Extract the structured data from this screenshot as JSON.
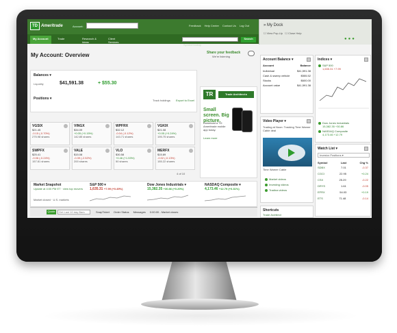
{
  "header": {
    "logo_box": "TD",
    "logo_name": "Ameritrade",
    "account_label": "Account:",
    "links": [
      "Feedback",
      "Help Center",
      "Contact Us",
      "Log Out"
    ],
    "search_button": "Search",
    "symbol_lookup": "Symbol lookup"
  },
  "nav": {
    "tabs": [
      "My Account",
      "Trade",
      "Research & Ideas",
      "Client Services"
    ]
  },
  "dock": {
    "title": "My Dock",
    "option1": "View Pop-Up",
    "option2": "Close Help"
  },
  "page": {
    "title": "My Account: Overview",
    "feedback": "Share your feedback",
    "feedback_sub": "We're listening"
  },
  "balances": {
    "title": "Balances",
    "label": "Liquidity",
    "value": "$41,591.38",
    "change": "+ $55.30"
  },
  "positions": {
    "title": "Positions",
    "track": "Track holdings",
    "export": "Export to Excel",
    "nav": "4 of 10",
    "cards": [
      {
        "symbol": "VGSIX",
        "price": "$21.45",
        "change": "-0.15 (-0.70%)",
        "shares": "275.98 shares",
        "dir": "dn"
      },
      {
        "symbol": "VINGX",
        "price": "$34.09",
        "change": "+0.05 (+0.15%)",
        "shares": "142.85 shares",
        "dir": "up"
      },
      {
        "symbol": "WPFRX",
        "price": "$32.12",
        "change": "-0.04 (-0.12%)",
        "shares": "143.71 shares",
        "dir": "dn"
      },
      {
        "symbol": "VGKIX",
        "price": "$21.08",
        "change": "+0.05 (+0.24%)",
        "shares": "195.75 shares",
        "dir": "up"
      },
      {
        "symbol": "SWPFX",
        "price": "$25.41",
        "change": "-0.06 (-0.24%)",
        "shares": "157.81 shares",
        "dir": "dn"
      },
      {
        "symbol": "VALE",
        "price": "$15.08",
        "change": "-0.39 (-2.52%)",
        "shares": "200 shares",
        "dir": "dn"
      },
      {
        "symbol": "VLO",
        "price": "$30.58",
        "change": "+0.46 (+1.53%)",
        "shares": "50 shares",
        "dir": "up"
      },
      {
        "symbol": "MERFX",
        "price": "$15.89",
        "change": "-0.02 (-0.13%)",
        "shares": "155.22 shares",
        "dir": "dn"
      }
    ]
  },
  "ad": {
    "badge": "TR",
    "button": "Trade Architect",
    "headline": "Small screen. Big picture.",
    "body": "Download a TD Ameritrade mobile app today.",
    "learn": "Learn more"
  },
  "market": {
    "title": "Market Snapshot",
    "text": "Update at 4:00 PM ET · view top movers",
    "status": "Market closed · U.S. markets",
    "sp": {
      "name": "S&P 500",
      "value": "1,635.31",
      "change": "+7.99 (+0.49%)"
    },
    "dow": {
      "name": "Dow Jones Industrials",
      "value": "15,382.35",
      "change": "+30.86 (+0.20%)"
    },
    "nasdaq": {
      "name": "NASDAQ Composite",
      "value": "4,173.46",
      "change": "+12.79 (+0.31%)"
    }
  },
  "statusbar": {
    "quote": "Quote",
    "quote_placeholder": "Get Last 10 day Bars",
    "items": [
      "SnapTicket",
      "Order Status",
      "Messages",
      "0:00:00 - Market closes"
    ]
  },
  "account_balance": {
    "title": "Account Balance",
    "col1": "Account",
    "col2": "Balance",
    "rows": [
      {
        "label": "Individual",
        "value": "$41,591.38"
      },
      {
        "label": "Cash & sweep vehicle",
        "value": "$555.52"
      },
      {
        "label": "Stocks",
        "value": "$600.00"
      },
      {
        "label": "Account value",
        "value": "$41,591.38"
      }
    ]
  },
  "indices": {
    "title": "Indices",
    "item1": "S&P 500",
    "item1_value": "1,635.31 +7.99",
    "item2": "Dow Jones Industrials",
    "item2_value": "15,382.35 +30.86",
    "item3": "NASDAQ Composite",
    "item3_value": "4,173.46 +12.79"
  },
  "video": {
    "title": "Video Player",
    "caption": "Trading at Noon: Tracking Time Warner Cable deal",
    "thumb_label": "Time Warner Cable",
    "items": [
      "Market videos",
      "Investing videos",
      "Tradina videos"
    ]
  },
  "watchlist": {
    "title": "Watch List",
    "select": "Investor Positions",
    "headers": [
      "Symbol",
      "Last",
      "Chg %"
    ],
    "rows": [
      {
        "s": "SDBX",
        "l": "7.01",
        "c": "-0.37",
        "dir": "dn"
      },
      {
        "s": "CGCI",
        "l": "22.95",
        "c": "+0.24",
        "dir": "up"
      },
      {
        "s": "CSX",
        "l": "25.29",
        "c": "-0.22",
        "dir": "dn"
      },
      {
        "s": "DRYS",
        "l": "1.61",
        "c": "-0.05",
        "dir": "dn"
      },
      {
        "s": "EFRX",
        "l": "54.03",
        "c": "+0.19",
        "dir": "up"
      },
      {
        "s": "ETS",
        "l": "71.48",
        "c": "-0.14",
        "dir": "dn"
      }
    ]
  },
  "shortcuts": {
    "title": "Shortcuts",
    "link": "Trade Architect"
  },
  "colors": {
    "brand_green": "#3c7a2e",
    "accent_green": "#2e9c2e",
    "down_red": "#c0392b"
  }
}
